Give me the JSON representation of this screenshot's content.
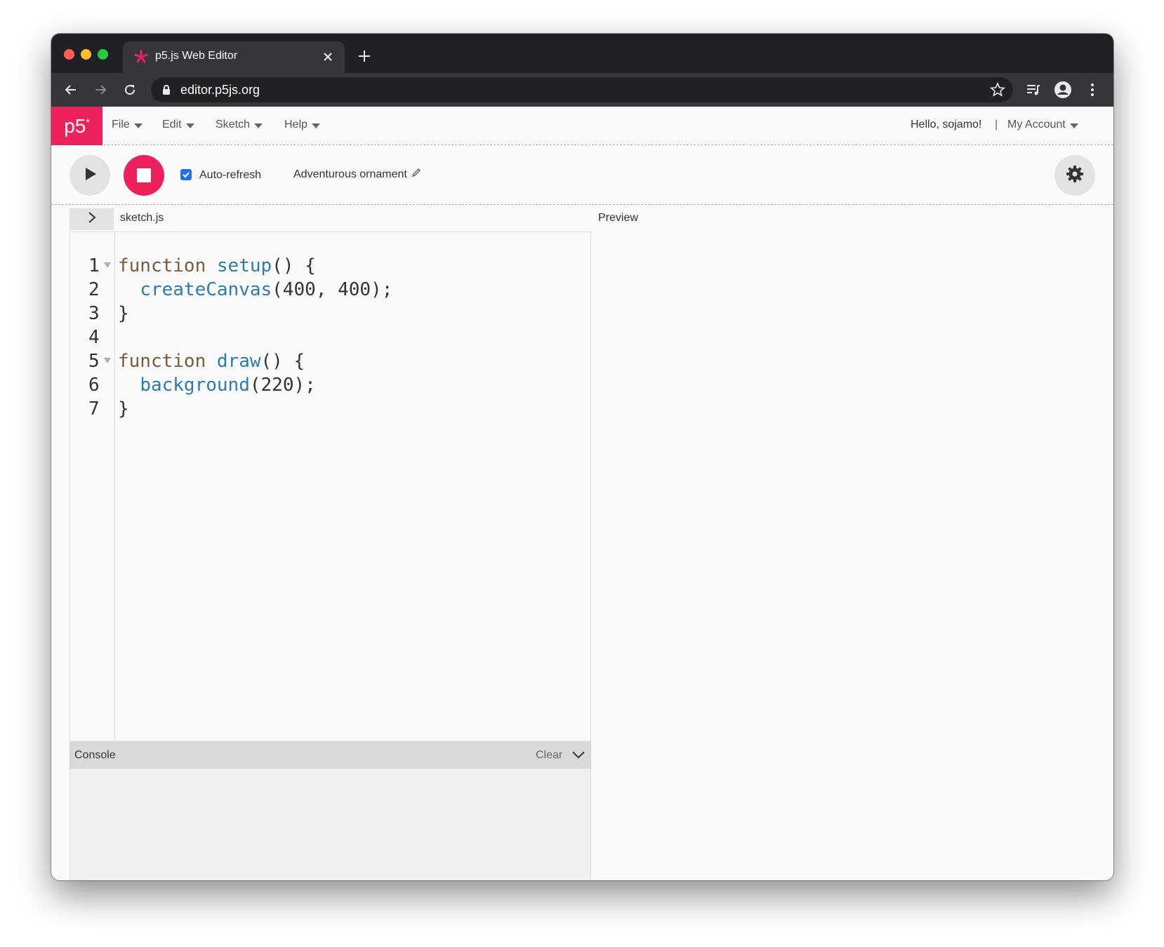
{
  "browser": {
    "tab_title": "p5.js Web Editor",
    "url": "editor.p5js.org",
    "icons": {
      "favicon": "p5-asterisk-icon",
      "close": "close-icon",
      "new_tab": "plus-icon",
      "back": "arrow-left-icon",
      "forward": "arrow-right-icon",
      "reload": "reload-icon",
      "lock": "lock-icon",
      "bookmark": "star-icon",
      "media": "playlist-icon",
      "profile": "account-circle-icon",
      "menu": "kebab-menu-icon"
    }
  },
  "app": {
    "logo_text": "p5",
    "logo_mark": "*",
    "brand_color": "#ed225d",
    "menus": [
      {
        "label": "File"
      },
      {
        "label": "Edit"
      },
      {
        "label": "Sketch"
      },
      {
        "label": "Help"
      }
    ],
    "greeting": "Hello, sojamo!",
    "separator": "|",
    "account_label": "My Account"
  },
  "controls": {
    "auto_refresh_label": "Auto-refresh",
    "auto_refresh_checked": true,
    "sketch_name": "Adventurous ornament",
    "icons": {
      "play": "play-icon",
      "stop": "stop-icon",
      "edit": "pencil-icon",
      "settings": "gear-icon"
    }
  },
  "editor": {
    "file_name": "sketch.js",
    "line_numbers": [
      "1",
      "2",
      "3",
      "4",
      "5",
      "6",
      "7"
    ],
    "code": [
      {
        "kw": "function ",
        "fn": "setup",
        "rest": "() {"
      },
      {
        "indent": "  ",
        "fn": "createCanvas",
        "rest": "(400, 400);"
      },
      {
        "rest": "}"
      },
      {
        "rest": ""
      },
      {
        "kw": "function ",
        "fn": "draw",
        "rest": "() {"
      },
      {
        "indent": "  ",
        "fn": "background",
        "rest": "(220);"
      },
      {
        "rest": "}"
      }
    ]
  },
  "console": {
    "title": "Console",
    "clear_label": "Clear"
  },
  "preview": {
    "label": "Preview"
  }
}
